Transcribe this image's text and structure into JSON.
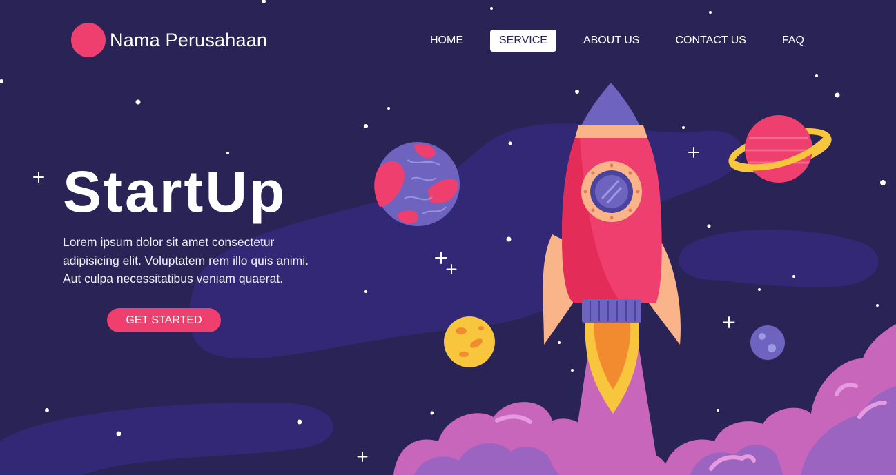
{
  "header": {
    "brand": "Nama Perusahaan",
    "nav": [
      {
        "label": "HOME",
        "active": false
      },
      {
        "label": "SERVICE",
        "active": true
      },
      {
        "label": "ABOUT US",
        "active": false
      },
      {
        "label": "CONTACT US",
        "active": false
      },
      {
        "label": "FAQ",
        "active": false
      }
    ]
  },
  "hero": {
    "title": "StartUp",
    "description": "Lorem ipsum dolor sit amet consectetur adipisicing elit. Voluptatem rem illo quis animi. Aut culpa necessitatibus veniam quaerat.",
    "cta_label": "GET STARTED"
  },
  "colors": {
    "background": "#2a2356",
    "accent": "#ef3f6e",
    "rocket_body": "#ef3f6e",
    "rocket_nose": "#6e64c0",
    "cloud": "#c866bb",
    "planet_yellow": "#f8c63d"
  },
  "illustration": {
    "icons": [
      "rocket-icon",
      "planet-icon",
      "ringed-planet-icon",
      "moon-icon",
      "cloud-icon",
      "star-icon"
    ]
  }
}
